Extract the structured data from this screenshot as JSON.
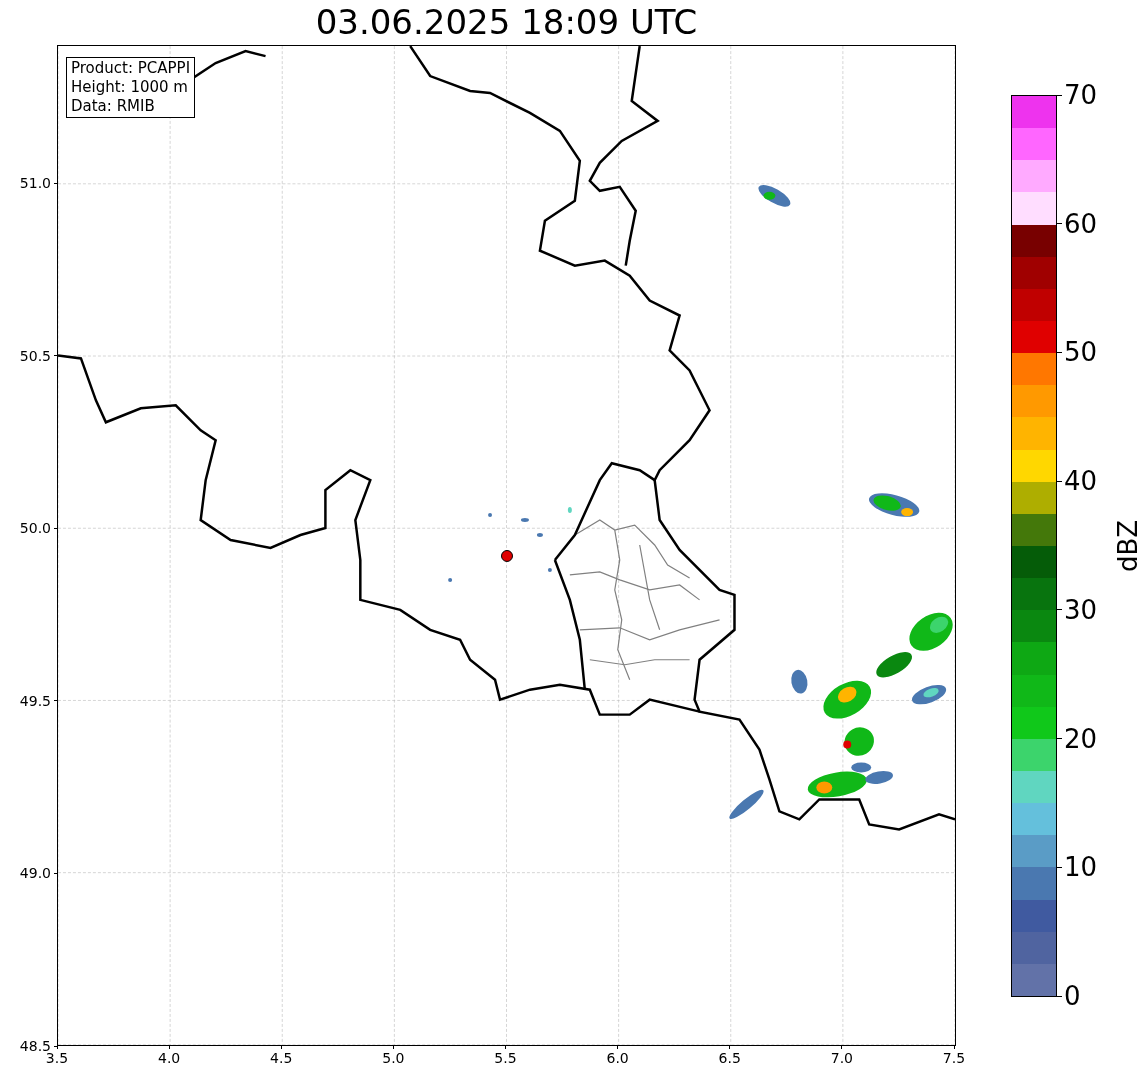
{
  "title": "03.06.2025 18:09 UTC",
  "info_box": [
    "Product: PCAPPI",
    "Height: 1000 m",
    "Data: RMIB"
  ],
  "map": {
    "xticks": [
      "3.5",
      "4.0",
      "4.5",
      "5.0",
      "5.5",
      "6.0",
      "6.5",
      "7.0",
      "7.5"
    ],
    "yticks": [
      "51.0",
      "50.5",
      "50.0",
      "49.5",
      "49.0",
      "48.5"
    ]
  },
  "colorbar": {
    "label": "dBZ",
    "ticks": [
      "70",
      "60",
      "50",
      "40",
      "30",
      "20",
      "10",
      "0"
    ],
    "segments": [
      {
        "color": "#ee33ee"
      },
      {
        "color": "#ff66ff"
      },
      {
        "color": "#ffaaff"
      },
      {
        "color": "#ffddff"
      },
      {
        "color": "#780000"
      },
      {
        "color": "#a00000"
      },
      {
        "color": "#c00000"
      },
      {
        "color": "#e00000"
      },
      {
        "color": "#ff7700"
      },
      {
        "color": "#ff9900"
      },
      {
        "color": "#ffb400"
      },
      {
        "color": "#ffd700"
      },
      {
        "color": "#aeae00"
      },
      {
        "color": "#44780a"
      },
      {
        "color": "#055c08"
      },
      {
        "color": "#08740e"
      },
      {
        "color": "#0a8810"
      },
      {
        "color": "#0ea814"
      },
      {
        "color": "#10b818"
      },
      {
        "color": "#10c81a"
      },
      {
        "color": "#3cd46c"
      },
      {
        "color": "#60d6c0"
      },
      {
        "color": "#64c0dc"
      },
      {
        "color": "#5a9cc6"
      },
      {
        "color": "#4a78b0"
      },
      {
        "color": "#405aa0"
      },
      {
        "color": "#5064a0"
      },
      {
        "color": "#6272a8"
      }
    ]
  }
}
